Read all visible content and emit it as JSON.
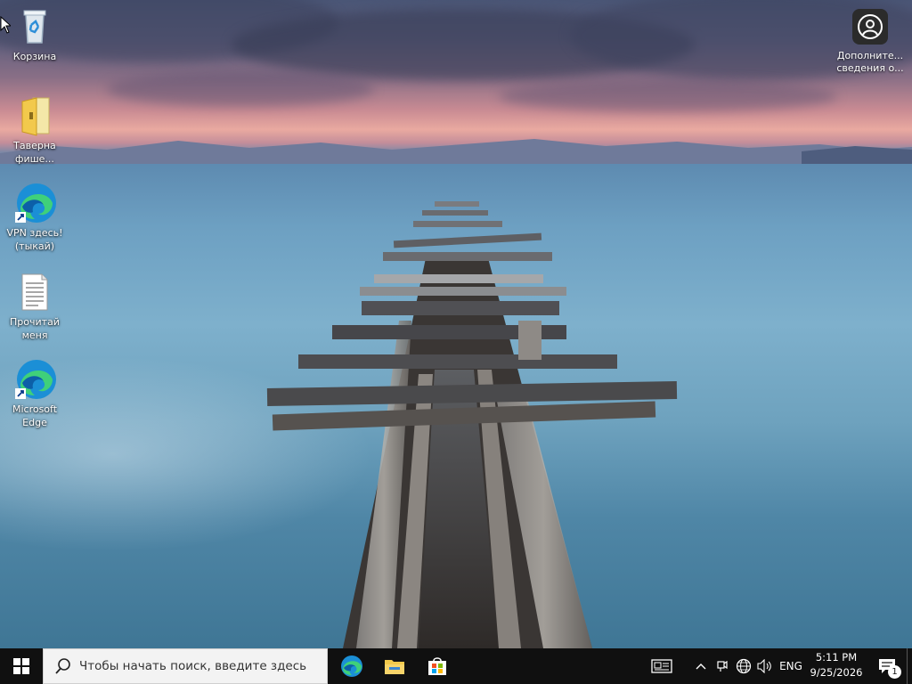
{
  "desktop": {
    "icons": [
      {
        "label": "Корзина",
        "icon": "recycle-bin-icon"
      },
      {
        "label": "Таверна фише...",
        "icon": "folder-icon"
      },
      {
        "label": "VPN здесь! (тыкай)",
        "icon": "edge-shortcut-icon"
      },
      {
        "label": "Прочитай меня",
        "icon": "text-document-icon"
      },
      {
        "label": "Microsoft Edge",
        "icon": "edge-shortcut-icon"
      }
    ],
    "info_widget": {
      "label": "Дополните... сведения о...",
      "icon": "user-circle-icon"
    }
  },
  "taskbar": {
    "search_placeholder": "Чтобы начать поиск, введите здесь",
    "pinned_apps": [
      "edge-icon",
      "file-explorer-icon",
      "microsoft-store-icon"
    ],
    "tray": {
      "language": "ENG",
      "time": "5:11 PM",
      "date": "9/25/2026",
      "notification_count": "1"
    }
  },
  "colors": {
    "taskbar_bg": "#101010",
    "search_bg": "#f3f3f3",
    "accent": "#0078d4"
  }
}
